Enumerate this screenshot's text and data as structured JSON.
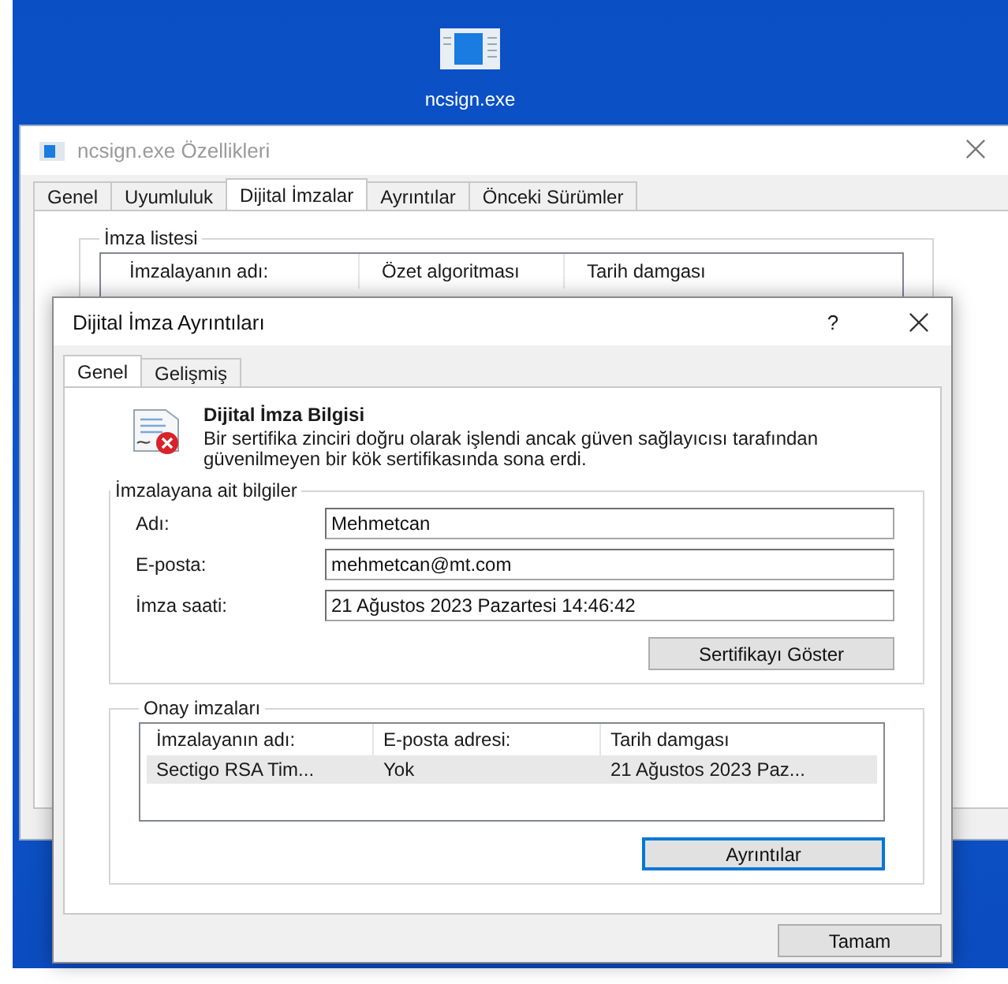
{
  "desktop_icon": {
    "label": "ncsign.exe"
  },
  "properties_window": {
    "title": "ncsign.exe Özellikleri",
    "tabs": [
      {
        "label": "Genel",
        "selected": false
      },
      {
        "label": "Uyumluluk",
        "selected": false
      },
      {
        "label": "Dijital İmzalar",
        "selected": true
      },
      {
        "label": "Ayrıntılar",
        "selected": false
      },
      {
        "label": "Önceki Sürümler",
        "selected": false
      }
    ],
    "group_title": "İmza listesi",
    "columns": [
      "İmzalayanın adı:",
      "Özet algoritması",
      "Tarih damgası"
    ]
  },
  "dialog": {
    "title": "Dijital İmza Ayrıntıları",
    "help": "?",
    "tabs": [
      {
        "label": "Genel",
        "selected": true
      },
      {
        "label": "Gelişmiş",
        "selected": false
      }
    ],
    "info": {
      "title": "Dijital İmza Bilgisi",
      "message": "Bir sertifika zinciri doğru olarak işlendi ancak güven sağlayıcısı tarafından güvenilmeyen bir kök sertifikasında sona erdi."
    },
    "signer_group": {
      "title": "İmzalayana ait bilgiler",
      "fields": [
        {
          "label": "Adı:",
          "value": "Mehmetcan"
        },
        {
          "label": "E-posta:",
          "value": "mehmetcan@mt.com"
        },
        {
          "label": "İmza saati:",
          "value": "21 Ağustos 2023 Pazartesi 14:46:42"
        }
      ],
      "button": "Sertifikayı Göster"
    },
    "countersign_group": {
      "title": "Onay imzaları",
      "columns": [
        "İmzalayanın adı:",
        "E-posta adresi:",
        "Tarih damgası"
      ],
      "rows": [
        {
          "cells": [
            "Sectigo RSA Tim...",
            "Yok",
            "21 Ağustos 2023 Paz..."
          ],
          "selected": true
        }
      ],
      "button": "Ayrıntılar"
    },
    "ok_button": "Tamam"
  }
}
